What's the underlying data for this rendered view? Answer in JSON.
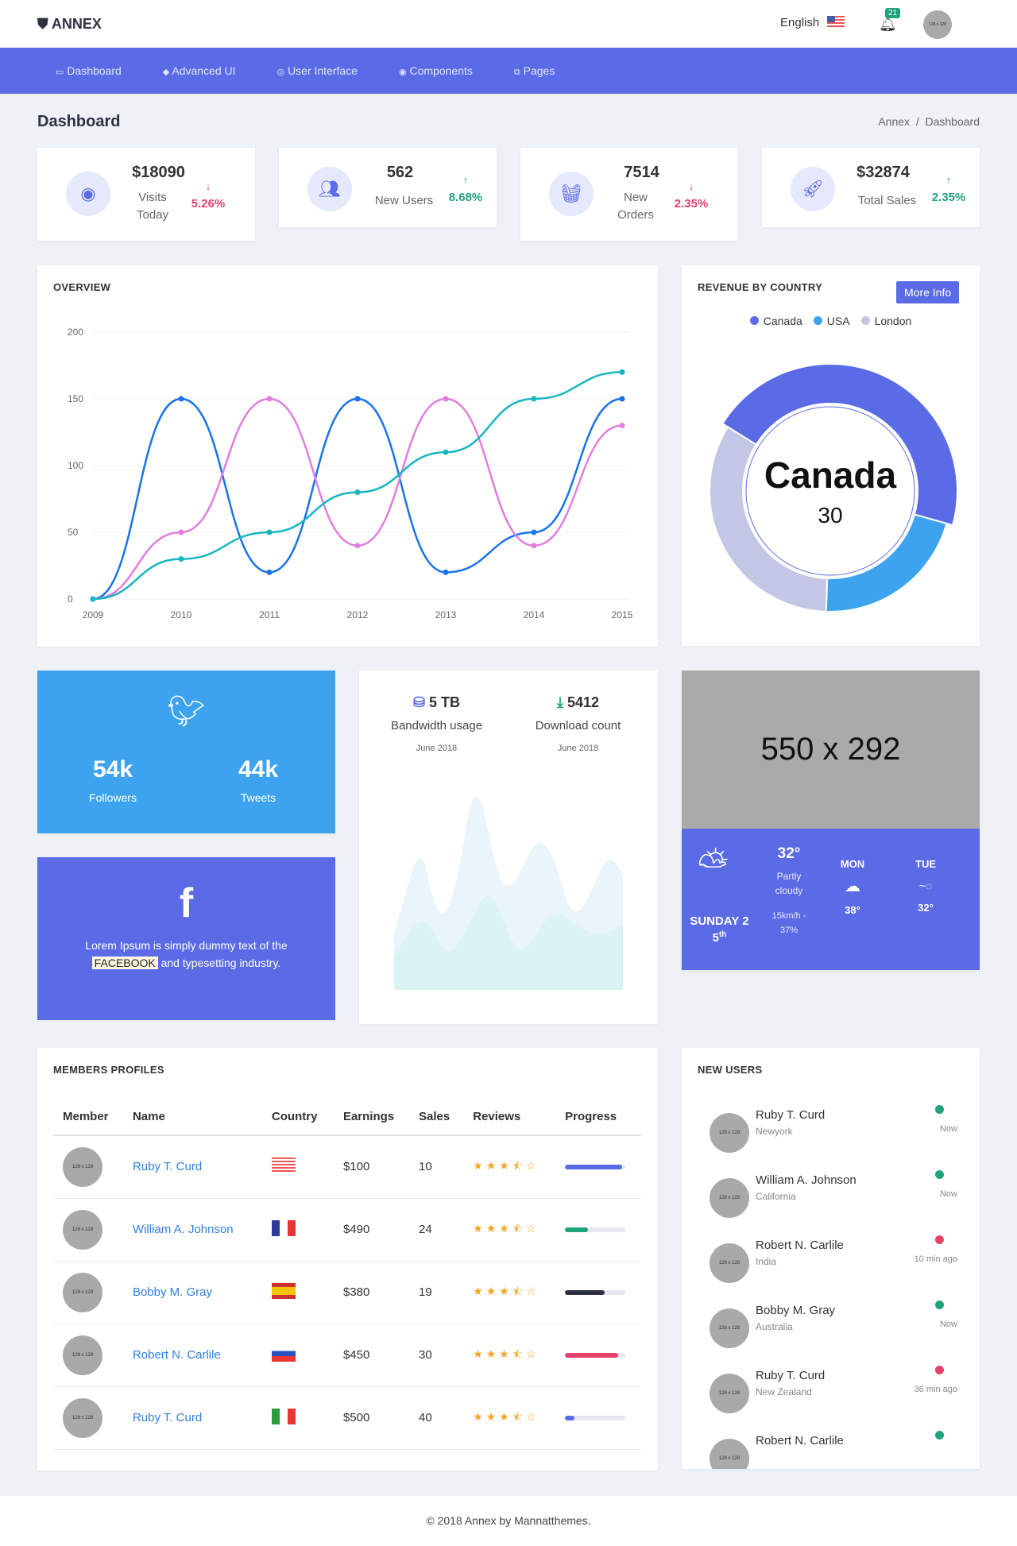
{
  "header": {
    "logo": "ANNEX",
    "language": "English",
    "notification_count": "21",
    "avatar_text": "128 x 128"
  },
  "nav": [
    {
      "label": "Dashboard",
      "icon": "monitor-icon"
    },
    {
      "label": "Advanced UI",
      "icon": "diamond-icon"
    },
    {
      "label": "User Interface",
      "icon": "target-icon"
    },
    {
      "label": "Components",
      "icon": "life-ring-icon"
    },
    {
      "label": "Pages",
      "icon": "copy-icon"
    }
  ],
  "page": {
    "title": "Dashboard",
    "breadcrumb": [
      "Annex",
      "Dashboard"
    ]
  },
  "stats": [
    {
      "value": "$18090",
      "label": "Visits Today",
      "change": "5.26%",
      "direction": "down",
      "icon": "webcam-icon"
    },
    {
      "value": "562",
      "label": "New Users",
      "change": "8.68%",
      "direction": "up",
      "icon": "users-icon"
    },
    {
      "value": "7514",
      "label": "New Orders",
      "change": "2.35%",
      "direction": "down",
      "icon": "basket-icon"
    },
    {
      "value": "$32874",
      "label": "Total Sales",
      "change": "2.35%",
      "direction": "up",
      "icon": "rocket-icon"
    }
  ],
  "overview": {
    "title": "OVERVIEW"
  },
  "chart_data": [
    {
      "type": "line",
      "x": [
        "2009",
        "2010",
        "2011",
        "2012",
        "2013",
        "2014",
        "2015"
      ],
      "ylim": [
        0,
        200
      ],
      "yticks": [
        0,
        50,
        100,
        150,
        200
      ],
      "grid": true,
      "series": [
        {
          "color": "#1a73e8",
          "values": [
            0,
            150,
            20,
            150,
            20,
            50,
            150
          ]
        },
        {
          "color": "#e27de0",
          "values": [
            0,
            50,
            150,
            40,
            150,
            40,
            130
          ]
        },
        {
          "color": "#16b6c2",
          "values": [
            0,
            30,
            50,
            80,
            110,
            150,
            170
          ]
        }
      ]
    },
    {
      "type": "pie",
      "title": "REVENUE BY COUNTRY",
      "legend": "top",
      "categories": [
        "Canada",
        "USA",
        "London"
      ],
      "values": [
        30,
        14,
        22
      ],
      "colors": [
        "#5b6be6",
        "#3ea3ef",
        "#c3c6e4"
      ],
      "center_label": "Canada",
      "center_value": "30"
    }
  ],
  "revenue": {
    "title": "REVENUE BY COUNTRY",
    "button": "More Info"
  },
  "twitter": {
    "followers": "54k",
    "followers_label": "Followers",
    "tweets": "44k",
    "tweets_label": "Tweets"
  },
  "facebook": {
    "text_before": "Lorem Ipsum is simply dummy text of the",
    "highlight": "FACEBOOK",
    "text_after": "and typesetting industry."
  },
  "bandwidth": {
    "value": "5 TB",
    "label": "Bandwidth usage",
    "date": "June 2018"
  },
  "download": {
    "value": "5412",
    "label": "Download count",
    "date": "June 2018"
  },
  "weather": {
    "image_text": "550 x 292",
    "day": "SUNDAY 25",
    "day_suffix": "th",
    "temp": "32°",
    "condition": "Partly cloudy",
    "wind": "15km/h - 37%",
    "forecast": [
      {
        "day": "MON",
        "temp": "38°"
      },
      {
        "day": "TUE",
        "temp": "32°"
      }
    ]
  },
  "members": {
    "title": "MEMBERS PROFILES",
    "columns": [
      "Member",
      "Name",
      "Country",
      "Earnings",
      "Sales",
      "Reviews",
      "Progress"
    ],
    "rows": [
      {
        "avatar": "128 x 128",
        "name": "Ruby T. Curd",
        "country": "USA",
        "earnings": "$100",
        "sales": "10",
        "rating": 3.5,
        "progress": 95,
        "color": "#5b6be6"
      },
      {
        "avatar": "128 x 128",
        "name": "William A. Johnson",
        "country": "France",
        "earnings": "$490",
        "sales": "24",
        "rating": 3.5,
        "progress": 38,
        "color": "#20a37c"
      },
      {
        "avatar": "128 x 128",
        "name": "Bobby M. Gray",
        "country": "Spain",
        "earnings": "$380",
        "sales": "19",
        "rating": 3.5,
        "progress": 65,
        "color": "#2d3142"
      },
      {
        "avatar": "128 x 128",
        "name": "Robert N. Carlile",
        "country": "Russia",
        "earnings": "$450",
        "sales": "30",
        "rating": 3.5,
        "progress": 88,
        "color": "#e6416a"
      },
      {
        "avatar": "128 x 128",
        "name": "Ruby T. Curd",
        "country": "Italy",
        "earnings": "$500",
        "sales": "40",
        "rating": 3.5,
        "progress": 15,
        "color": "#5b6be6"
      }
    ]
  },
  "new_users": {
    "title": "NEW USERS",
    "items": [
      {
        "name": "Ruby T. Curd",
        "location": "Newyork",
        "time": "Now",
        "status": "#20a37c"
      },
      {
        "name": "William A. Johnson",
        "location": "California",
        "time": "Now",
        "status": "#20a37c"
      },
      {
        "name": "Robert N. Carlile",
        "location": "India",
        "time": "10 min ago",
        "status": "#e6416a"
      },
      {
        "name": "Bobby M. Gray",
        "location": "Australia",
        "time": "Now",
        "status": "#20a37c"
      },
      {
        "name": "Ruby T. Curd",
        "location": "New Zealand",
        "time": "36 min ago",
        "status": "#e6416a"
      },
      {
        "name": "Robert N. Carlile",
        "location": "",
        "time": "",
        "status": "#20a37c"
      }
    ]
  },
  "footer": "© 2018 Annex by Mannatthemes."
}
